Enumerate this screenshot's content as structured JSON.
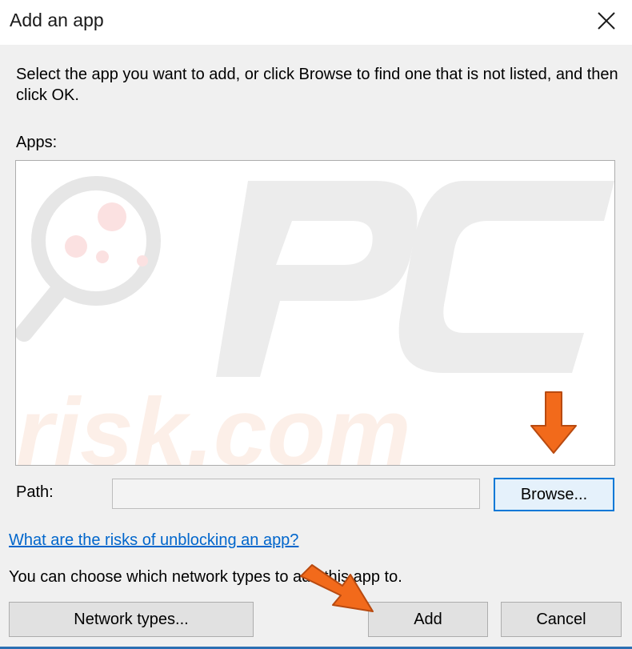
{
  "dialog": {
    "title": "Add an app",
    "close_icon": "close-icon"
  },
  "instructions": "Select the app you want to add, or click Browse to find one that is not listed, and then click OK.",
  "apps": {
    "label": "Apps:",
    "items": []
  },
  "path": {
    "label": "Path:",
    "value": ""
  },
  "buttons": {
    "browse": "Browse...",
    "network_types": "Network types...",
    "add": "Add",
    "cancel": "Cancel"
  },
  "risk_link": "What are the risks of unblocking an app?",
  "network_text": "You can choose which network types to add this app to.",
  "watermark": {
    "logo_text": "PC",
    "site_text": "risk.com"
  },
  "annotations": {
    "arrow_color": "#f26a1b",
    "arrow_icons": [
      "arrow-down-icon",
      "arrow-diagonal-icon"
    ]
  }
}
